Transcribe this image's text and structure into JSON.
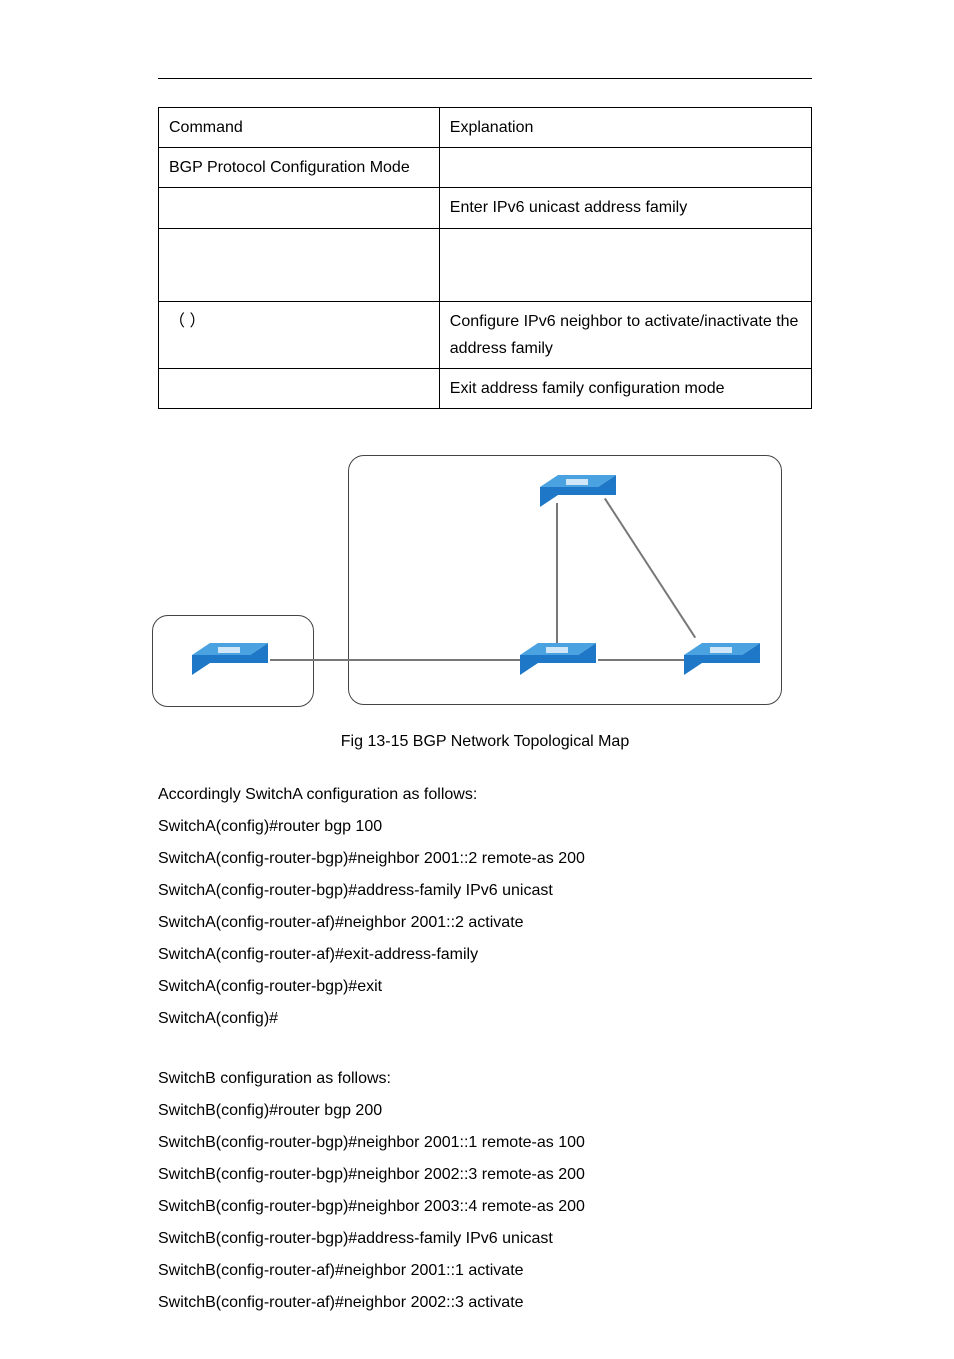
{
  "table": {
    "header": {
      "left": "Command",
      "right": "Explanation"
    },
    "rows": [
      {
        "left": "BGP Protocol Configuration Mode",
        "right": ""
      },
      {
        "left": "",
        "right": "Enter IPv6 unicast address family"
      },
      {
        "left": "",
        "right": ""
      },
      {
        "left": "（    ）",
        "right": "Configure IPv6 neighbor to activate/inactivate the address family"
      },
      {
        "left": "",
        "right": "Exit address family configuration mode"
      }
    ]
  },
  "figure_caption": "Fig 13-15 BGP Network Topological Map",
  "body": [
    "Accordingly SwitchA configuration as follows:",
    "SwitchA(config)#router bgp 100",
    "SwitchA(config-router-bgp)#neighbor 2001::2 remote-as 200",
    "SwitchA(config-router-bgp)#address-family IPv6 unicast",
    "SwitchA(config-router-af)#neighbor 2001::2 activate",
    "SwitchA(config-router-af)#exit-address-family",
    "SwitchA(config-router-bgp)#exit",
    "SwitchA(config)#",
    "",
    "SwitchB configuration as follows:",
    "SwitchB(config)#router bgp 200",
    "SwitchB(config-router-bgp)#neighbor 2001::1 remote-as 100",
    "SwitchB(config-router-bgp)#neighbor 2002::3 remote-as 200",
    "SwitchB(config-router-bgp)#neighbor 2003::4 remote-as 200",
    "SwitchB(config-router-bgp)#address-family IPv6 unicast",
    "SwitchB(config-router-af)#neighbor 2001::1 activate",
    "SwitchB(config-router-af)#neighbor 2002::3 activate"
  ]
}
